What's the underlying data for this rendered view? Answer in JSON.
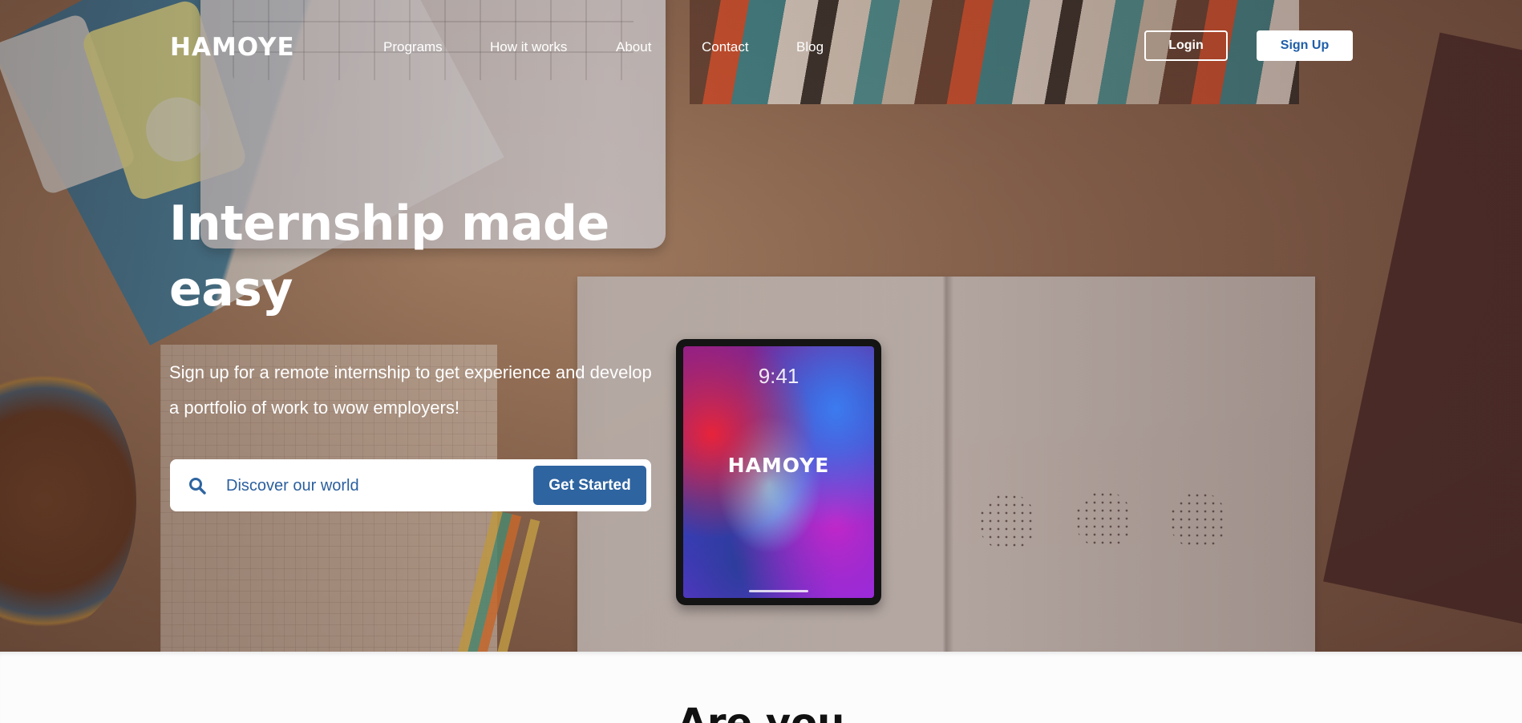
{
  "brand": {
    "name": "HAMOYE"
  },
  "nav": {
    "links": [
      "Programs",
      "How it works",
      "About",
      "Contact",
      "Blog"
    ],
    "login_label": "Login",
    "signup_label": "Sign Up"
  },
  "hero": {
    "title": "Internship made easy",
    "subtitle": "Sign up for a remote internship to get experience and develop a portfolio of work to wow employers!",
    "search_placeholder": "Discover our world",
    "cta_label": "Get Started"
  },
  "tablet": {
    "time": "9:41",
    "logo": "HAMOYE"
  },
  "section": {
    "title": "Are you"
  },
  "colors": {
    "primary": "#2e64a0",
    "signup_text": "#1f5ea8",
    "white": "#ffffff"
  },
  "icons": {
    "search": "search-icon",
    "logo_mark": "logo-h-icon"
  }
}
